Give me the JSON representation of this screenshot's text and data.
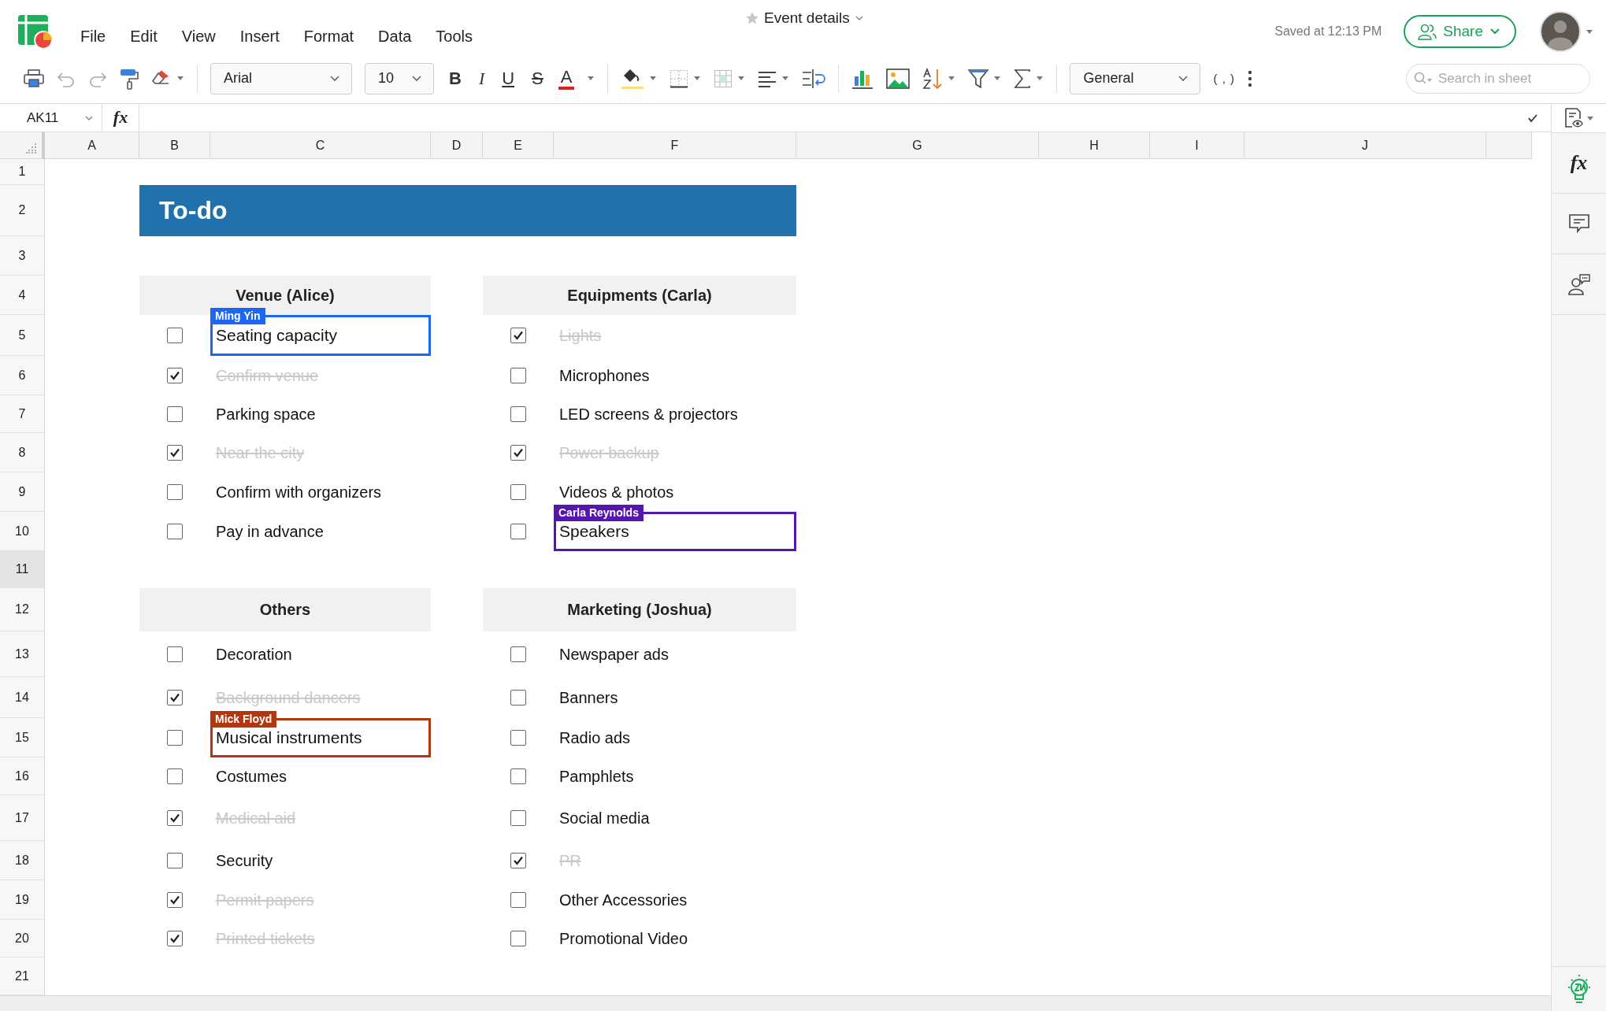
{
  "app": {
    "menu": [
      "File",
      "Edit",
      "View",
      "Insert",
      "Format",
      "Data",
      "Tools"
    ],
    "document": {
      "title": "Event details",
      "starred": false
    },
    "saved_status": "Saved at 12:13 PM",
    "share_button": "Share"
  },
  "toolbar": {
    "font": "Arial",
    "font_size": "10",
    "text_format": [
      "B",
      "I",
      "U",
      "S",
      "A"
    ],
    "number_format": "General",
    "comma_style": "( , )",
    "search": {
      "placeholder": "Search in sheet"
    }
  },
  "formula_bar": {
    "name_box": "AK11",
    "fx": "fx"
  },
  "sheet": {
    "columns": [
      "A",
      "B",
      "C",
      "D",
      "E",
      "F",
      "G",
      "H",
      "I",
      "J"
    ],
    "rows": [
      {
        "label": "1",
        "selected": false
      },
      {
        "label": "2",
        "selected": false
      },
      {
        "label": "3",
        "selected": false
      },
      {
        "label": "4",
        "selected": false
      },
      {
        "label": "5",
        "selected": false
      },
      {
        "label": "6",
        "selected": false
      },
      {
        "label": "7",
        "selected": false
      },
      {
        "label": "8",
        "selected": false
      },
      {
        "label": "9",
        "selected": false
      },
      {
        "label": "10",
        "selected": false
      },
      {
        "label": "11",
        "selected": true
      },
      {
        "label": "12",
        "selected": false
      },
      {
        "label": "13",
        "selected": false
      },
      {
        "label": "14",
        "selected": false
      },
      {
        "label": "15",
        "selected": false
      },
      {
        "label": "16",
        "selected": false
      },
      {
        "label": "17",
        "selected": false
      },
      {
        "label": "18",
        "selected": false
      },
      {
        "label": "19",
        "selected": false
      },
      {
        "label": "20",
        "selected": false
      },
      {
        "label": "21",
        "selected": false
      }
    ],
    "title": "To-do",
    "sections": [
      {
        "header": "Venue (Alice)",
        "items": [
          {
            "text": "Seating capacity",
            "checked": false,
            "collaborator": {
              "name": "Ming Yin",
              "color": "#1b66f5"
            }
          },
          {
            "text": "Confirm venue",
            "checked": true
          },
          {
            "text": "Parking space",
            "checked": false
          },
          {
            "text": "Near the city",
            "checked": true
          },
          {
            "text": "Confirm with organizers",
            "checked": false
          },
          {
            "text": "Pay in advance",
            "checked": false
          }
        ]
      },
      {
        "header": "Equipments (Carla)",
        "items": [
          {
            "text": "Lights",
            "checked": true
          },
          {
            "text": "Microphones",
            "checked": false
          },
          {
            "text": "LED screens & projectors",
            "checked": false
          },
          {
            "text": "Power backup",
            "checked": true
          },
          {
            "text": "Videos & photos",
            "checked": false
          },
          {
            "text": "Speakers",
            "checked": false,
            "collaborator": {
              "name": "Carla Reynolds",
              "color": "#5516b0"
            }
          }
        ]
      },
      {
        "header": "Others",
        "items": [
          {
            "text": "Decoration",
            "checked": false
          },
          {
            "text": "Background dancers",
            "checked": true
          },
          {
            "text": "Musical instruments",
            "checked": false,
            "collaborator": {
              "name": "Mick Floyd",
              "color": "#b3360c"
            }
          },
          {
            "text": "Costumes",
            "checked": false
          },
          {
            "text": "Medical aid",
            "checked": true
          },
          {
            "text": "Security",
            "checked": false
          },
          {
            "text": "Permit papers",
            "checked": true
          },
          {
            "text": "Printed tickets",
            "checked": true
          }
        ]
      },
      {
        "header": "Marketing (Joshua)",
        "items": [
          {
            "text": "Newspaper ads",
            "checked": false
          },
          {
            "text": "Banners",
            "checked": false
          },
          {
            "text": "Radio ads",
            "checked": false
          },
          {
            "text": "Pamphlets",
            "checked": false
          },
          {
            "text": "Social media",
            "checked": false
          },
          {
            "text": "PR",
            "checked": true
          },
          {
            "text": "Other Accessories",
            "checked": false
          },
          {
            "text": "Promotional Video",
            "checked": false
          }
        ]
      }
    ]
  },
  "sidebar": {
    "fx": "fx"
  }
}
